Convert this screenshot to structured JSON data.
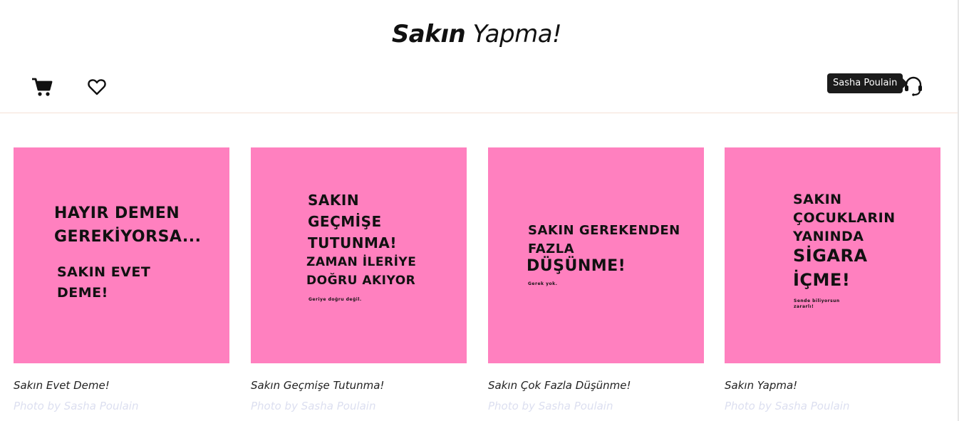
{
  "header": {
    "brand_bold": "Sakın",
    "brand_light": "Yapma!",
    "tooltip": "Sasha Poulain"
  },
  "icons": [
    "cart-icon",
    "heart-icon",
    "headset-icon"
  ],
  "colors": {
    "tile": "#ff80bf",
    "credit": "#dcdff0",
    "divider": "#f5e1d6",
    "tooltip_bg": "#1b1b1b"
  },
  "cards": [
    {
      "title": "Sakın Evet Deme!",
      "credit": "Photo by Sasha Poulain",
      "image_text": [
        "HAYIR DEMEN",
        "GEREKİYORSA...",
        "SAKIN EVET",
        "DEME!"
      ]
    },
    {
      "title": "Sakın Geçmişe Tutunma!",
      "credit": "Photo by Sasha Poulain",
      "image_text": [
        "SAKIN",
        "GEÇMİŞE",
        "TUTUNMA!",
        "ZAMAN İLERİYE",
        "DOĞRU AKIYOR",
        "Geriye doğru değil."
      ]
    },
    {
      "title": "Sakın Çok Fazla Düşünme!",
      "credit": "Photo by Sasha Poulain",
      "image_text": [
        "SAKIN GEREKENDEN",
        "FAZLA",
        "DÜŞÜNME!",
        "Gerek yok."
      ]
    },
    {
      "title": "Sakın Yapma!",
      "credit": "Photo by Sasha Poulain",
      "image_text": [
        "SAKIN",
        "ÇOCUKLARIN",
        "YANINDA",
        "SİGARA",
        "İÇME!",
        "Sende biliyorsun",
        "zararlı!"
      ]
    }
  ]
}
